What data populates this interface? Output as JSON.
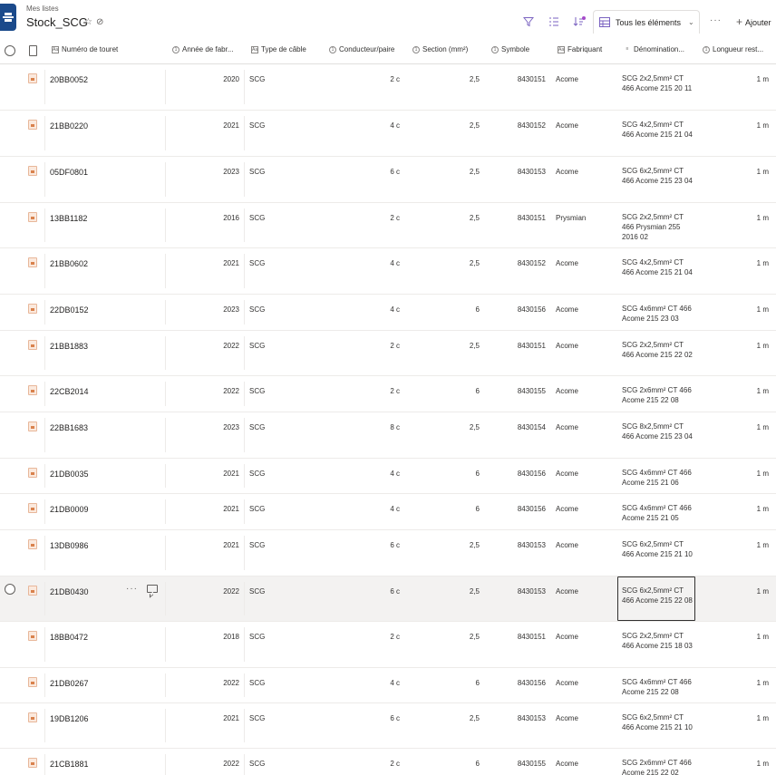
{
  "header": {
    "breadcrumb": "Mes listes",
    "title": "Stock_SCG",
    "view_label": "Tous les éléments",
    "add_column_label": "Ajouter"
  },
  "columns": {
    "numero": "Numéro de touret",
    "annee": "Année de fabr...",
    "type": "Type de câble",
    "conducteur": "Conducteur/paire",
    "section": "Section (mm²)",
    "symbole": "Symbole",
    "fabricant": "Fabriquant",
    "denomination": "Dénomination...",
    "longueur": "Longueur rest..."
  },
  "rows": [
    {
      "numero": "20BB0052",
      "annee": "2020",
      "type": "SCG",
      "conducteur": "2 c",
      "section": "2,5",
      "symbole": "8430151",
      "fabricant": "Acome",
      "denomination": "SCG 2x2,5mm² CT 466 Acome 215 20 11",
      "longueur": "1 m"
    },
    {
      "numero": "21BB0220",
      "annee": "2021",
      "type": "SCG",
      "conducteur": "4 c",
      "section": "2,5",
      "symbole": "8430152",
      "fabricant": "Acome",
      "denomination": "SCG 4x2,5mm² CT 466 Acome 215 21 04",
      "longueur": "1 m"
    },
    {
      "numero": "05DF0801",
      "annee": "2023",
      "type": "SCG",
      "conducteur": "6 c",
      "section": "2,5",
      "symbole": "8430153",
      "fabricant": "Acome",
      "denomination": "SCG 6x2,5mm² CT 466 Acome 215 23 04",
      "longueur": "1 m"
    },
    {
      "numero": "13BB1182",
      "annee": "2016",
      "type": "SCG",
      "conducteur": "2 c",
      "section": "2,5",
      "symbole": "8430151",
      "fabricant": "Prysmian",
      "denomination": "SCG 2x2,5mm² CT 466 Prysmian 255 2016 02",
      "longueur": "1 m"
    },
    {
      "numero": "21BB0602",
      "annee": "2021",
      "type": "SCG",
      "conducteur": "4 c",
      "section": "2,5",
      "symbole": "8430152",
      "fabricant": "Acome",
      "denomination": "SCG 4x2,5mm² CT 466 Acome 215 21 04",
      "longueur": "1 m"
    },
    {
      "numero": "22DB0152",
      "annee": "2023",
      "type": "SCG",
      "conducteur": "4 c",
      "section": "6",
      "symbole": "8430156",
      "fabricant": "Acome",
      "denomination": "SCG 4x6mm² CT 466 Acome 215 23 03",
      "longueur": "1 m"
    },
    {
      "numero": "21BB1883",
      "annee": "2022",
      "type": "SCG",
      "conducteur": "2 c",
      "section": "2,5",
      "symbole": "8430151",
      "fabricant": "Acome",
      "denomination": "SCG 2x2,5mm² CT 466 Acome 215 22 02",
      "longueur": "1 m"
    },
    {
      "numero": "22CB2014",
      "annee": "2022",
      "type": "SCG",
      "conducteur": "2 c",
      "section": "6",
      "symbole": "8430155",
      "fabricant": "Acome",
      "denomination": "SCG 2x6mm² CT 466 Acome 215 22 08",
      "longueur": "1 m"
    },
    {
      "numero": "22BB1683",
      "annee": "2023",
      "type": "SCG",
      "conducteur": "8 c",
      "section": "2,5",
      "symbole": "8430154",
      "fabricant": "Acome",
      "denomination": "SCG 8x2,5mm² CT 466 Acome 215 23 04",
      "longueur": "1 m"
    },
    {
      "numero": "21DB0035",
      "annee": "2021",
      "type": "SCG",
      "conducteur": "4 c",
      "section": "6",
      "symbole": "8430156",
      "fabricant": "Acome",
      "denomination": "SCG 4x6mm² CT 466 Acome 215 21 06",
      "longueur": "1 m"
    },
    {
      "numero": "21DB0009",
      "annee": "2021",
      "type": "SCG",
      "conducteur": "4 c",
      "section": "6",
      "symbole": "8430156",
      "fabricant": "Acome",
      "denomination": "SCG 4x6mm² CT 466 Acome 215 21 05",
      "longueur": "1 m"
    },
    {
      "numero": "13DB0986",
      "annee": "2021",
      "type": "SCG",
      "conducteur": "6 c",
      "section": "2,5",
      "symbole": "8430153",
      "fabricant": "Acome",
      "denomination": "SCG 6x2,5mm² CT 466 Acome 215 21 10",
      "longueur": "1 m"
    },
    {
      "numero": "21DB0430",
      "annee": "2022",
      "type": "SCG",
      "conducteur": "6 c",
      "section": "2,5",
      "symbole": "8430153",
      "fabricant": "Acome",
      "denomination": "SCG 6x2,5mm² CT 466 Acome 215 22 08",
      "longueur": "1 m",
      "selected": true
    },
    {
      "numero": "18BB0472",
      "annee": "2018",
      "type": "SCG",
      "conducteur": "2 c",
      "section": "2,5",
      "symbole": "8430151",
      "fabricant": "Acome",
      "denomination": "SCG 2x2,5mm² CT 466 Acome 215 18 03",
      "longueur": "1 m"
    },
    {
      "numero": "21DB0267",
      "annee": "2022",
      "type": "SCG",
      "conducteur": "4 c",
      "section": "6",
      "symbole": "8430156",
      "fabricant": "Acome",
      "denomination": "SCG 4x6mm² CT 466 Acome 215 22 08",
      "longueur": "1 m"
    },
    {
      "numero": "19DB1206",
      "annee": "2021",
      "type": "SCG",
      "conducteur": "6 c",
      "section": "2,5",
      "symbole": "8430153",
      "fabricant": "Acome",
      "denomination": "SCG 6x2,5mm² CT 466 Acome 215 21 10",
      "longueur": "1 m"
    },
    {
      "numero": "21CB1881",
      "annee": "2022",
      "type": "SCG",
      "conducteur": "2 c",
      "section": "6",
      "symbole": "8430155",
      "fabricant": "Acome",
      "denomination": "SCG 2x6mm² CT 466 Acome 215 22 02",
      "longueur": "1 m"
    }
  ],
  "colors": {
    "accent": "#7a62c0",
    "logo": "#1b4a8b",
    "selected_row": "#f3f2f1"
  },
  "icons": {
    "filter": "filter-icon",
    "group": "group-icon",
    "sort": "sort-icon",
    "view": "grid-view-icon"
  }
}
